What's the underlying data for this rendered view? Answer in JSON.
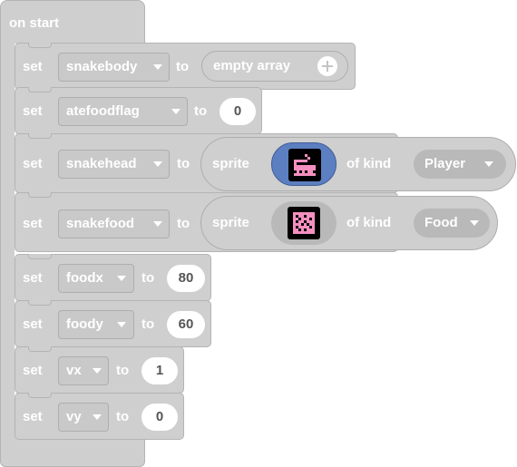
{
  "event": {
    "label": "on start"
  },
  "blocks": {
    "b1": {
      "keyword": "set",
      "variable": "snakebody",
      "to": "to",
      "value_label": "empty array"
    },
    "b2": {
      "keyword": "set",
      "variable": "atefoodflag",
      "to": "to",
      "value": "0"
    },
    "b3": {
      "keyword": "set",
      "variable": "snakehead",
      "to": "to",
      "sprite_label": "sprite",
      "of_kind": "of kind",
      "kind": "Player"
    },
    "b4": {
      "keyword": "set",
      "variable": "snakefood",
      "to": "to",
      "sprite_label": "sprite",
      "of_kind": "of kind",
      "kind": "Food"
    },
    "b5": {
      "keyword": "set",
      "variable": "foodx",
      "to": "to",
      "value": "80"
    },
    "b6": {
      "keyword": "set",
      "variable": "foody",
      "to": "to",
      "value": "60"
    },
    "b7": {
      "keyword": "set",
      "variable": "vx",
      "to": "to",
      "value": "1"
    },
    "b8": {
      "keyword": "set",
      "variable": "vy",
      "to": "to",
      "value": "0"
    }
  },
  "colors": {
    "block": "#cfcfcf",
    "selected_sprite_field": "#5b7fc0",
    "sprite_pixels": "#f58fc0"
  },
  "icons": {
    "add": "plus-circle-icon",
    "dropdown": "caret-down-icon"
  }
}
